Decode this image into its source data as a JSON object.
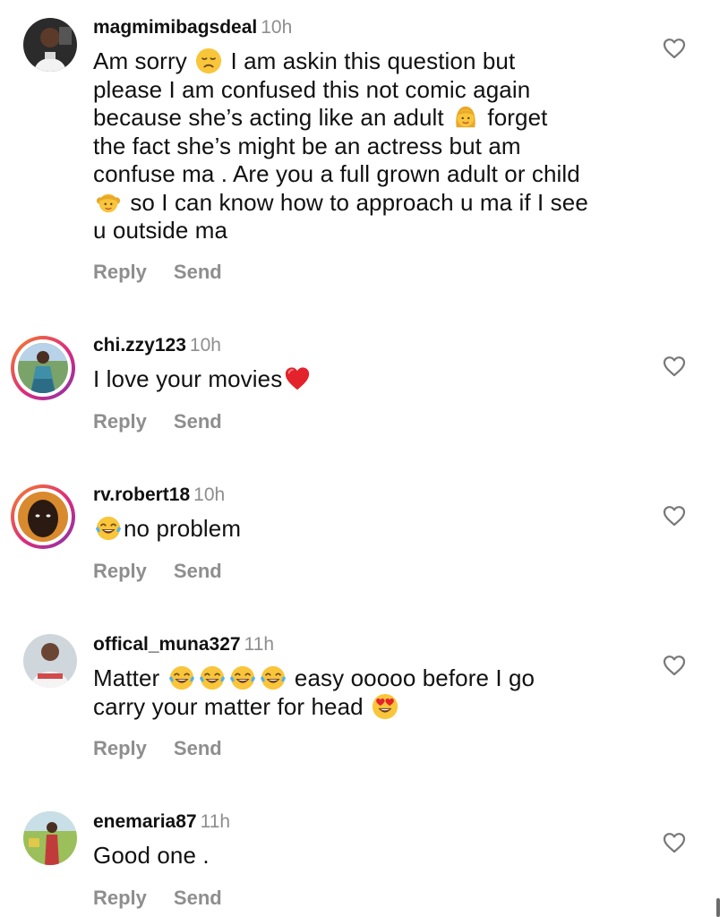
{
  "actions": {
    "reply_label": "Reply",
    "send_label": "Send"
  },
  "comments": [
    {
      "username": "magmimibagsdeal",
      "time": "10h",
      "lines": [
        [
          "Am sorry ",
          "{sad}",
          " I am askin this question but"
        ],
        [
          "please I am confused this not comic again"
        ],
        [
          "because she’s acting like an adult ",
          "{woman}",
          " forget"
        ],
        [
          "the fact she’s might be an actress but am"
        ],
        [
          "confuse ma . Are you a full grown adult or child"
        ],
        [
          "{girl}",
          " so I can know how to approach u ma if I see"
        ],
        [
          "u outside ma"
        ]
      ]
    },
    {
      "username": "chi.zzy123",
      "time": "10h",
      "lines": [
        [
          "I love your movies",
          "{heart}"
        ]
      ]
    },
    {
      "username": "rv.robert18",
      "time": "10h",
      "lines": [
        [
          "{joy}",
          "no problem"
        ]
      ]
    },
    {
      "username": "offical_muna327",
      "time": "11h",
      "lines": [
        [
          "Matter ",
          "{joy}",
          "{joy}",
          "{joy}",
          "{joy}",
          " easy ooooo before I go"
        ],
        [
          "carry your matter for head ",
          "{hearteyes}"
        ]
      ]
    },
    {
      "username": "enemaria87",
      "time": "11h",
      "lines": [
        [
          "Good one ."
        ]
      ]
    }
  ],
  "emoji_names": {
    "sad": "disappointed-face-emoji",
    "woman": "woman-emoji",
    "girl": "girl-emoji",
    "heart": "red-heart-emoji",
    "joy": "tears-of-joy-emoji",
    "hearteyes": "heart-eyes-emoji"
  },
  "colors": {
    "time": "#8e8e8e",
    "actions": "#8e8e8e",
    "story_ring_start": "#f58529",
    "story_ring_end": "#8134af"
  }
}
